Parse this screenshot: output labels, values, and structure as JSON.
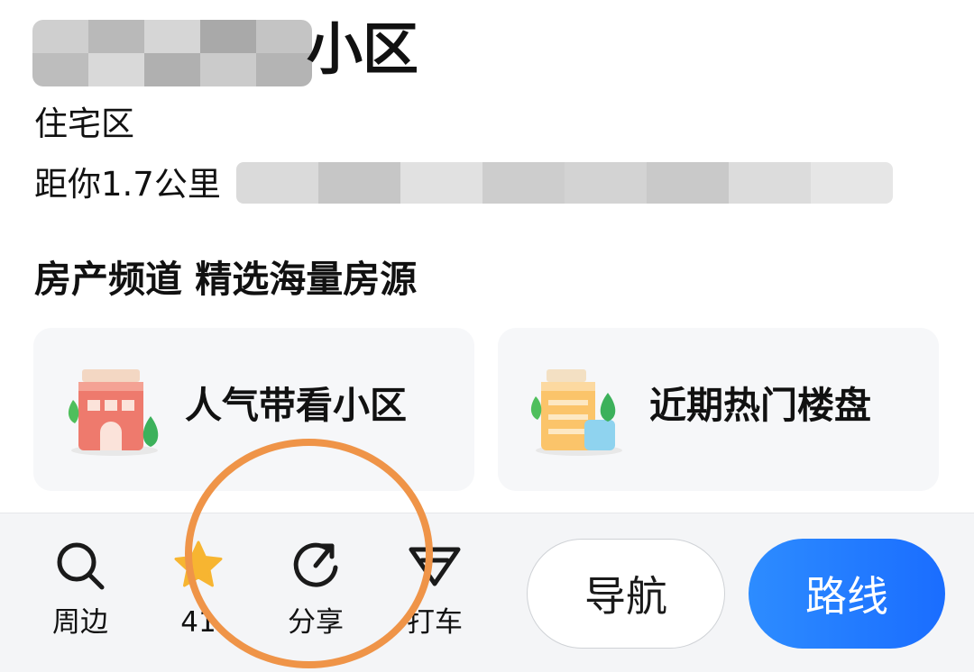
{
  "poi": {
    "title_suffix": "小区",
    "type": "住宅区",
    "distance": "距你1.7公里"
  },
  "house": {
    "section_title": "房产频道 精选海量房源",
    "cards": [
      {
        "label": "人气带看小区",
        "icon": "red-building-icon"
      },
      {
        "label": "近期热门楼盘",
        "icon": "yellow-building-icon"
      }
    ]
  },
  "toolbar": {
    "nearby_label": "周边",
    "favorite_label": "41",
    "share_label": "分享",
    "taxi_label": "打车",
    "navigate_label": "导航",
    "route_label": "路线"
  },
  "colors": {
    "accent_blue": "#1a6dff",
    "annotation_orange": "#ef9448",
    "star_yellow": "#f7b531"
  }
}
